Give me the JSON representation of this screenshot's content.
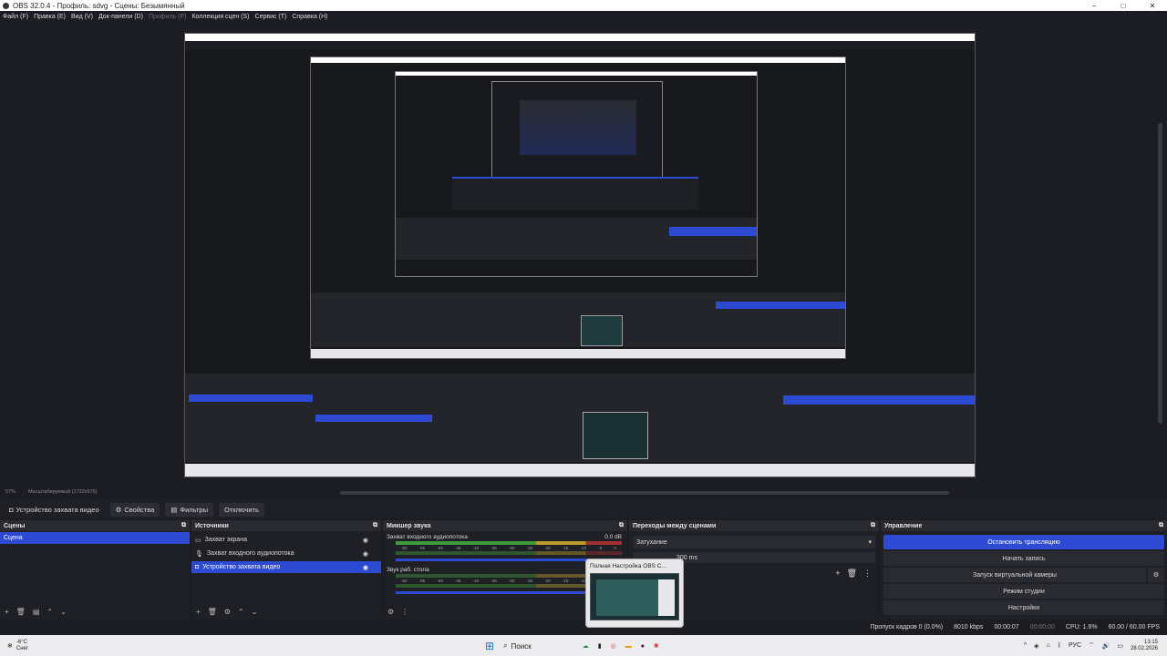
{
  "window": {
    "title": "OBS 32.0.4 - Профиль: sdvg - Сцены: Безымянный",
    "minimize": "–",
    "maximize": "□",
    "close": "✕"
  },
  "menu": [
    {
      "label": "Файл (F)",
      "disabled": false
    },
    {
      "label": "Правка (E)",
      "disabled": false
    },
    {
      "label": "Вид (V)",
      "disabled": false
    },
    {
      "label": "Док-панели (D)",
      "disabled": false
    },
    {
      "label": "Профиль (P)",
      "disabled": true
    },
    {
      "label": "Коллекция сцен (S)",
      "disabled": false
    },
    {
      "label": "Сервис (T)",
      "disabled": false
    },
    {
      "label": "Справка (H)",
      "disabled": false
    }
  ],
  "preview_bar": {
    "zoom": "57%",
    "scale_label": "Масштабируемый (1732x975)"
  },
  "toolbar": {
    "source_name": "Устройство захвата видео",
    "properties": "Свойства",
    "filters": "Фильтры",
    "deactivate": "Отключить"
  },
  "scenes": {
    "title": "Сцены",
    "items": [
      {
        "label": "Сцена",
        "selected": true
      }
    ]
  },
  "sources": {
    "title": "Источники",
    "items": [
      {
        "label": "Захват экрана",
        "icon": "monitor-icon",
        "selected": false
      },
      {
        "label": "Захват входного аудиопотока",
        "icon": "mic-icon",
        "selected": false
      },
      {
        "label": "Устройство захвата видео",
        "icon": "camera-icon",
        "selected": true
      }
    ]
  },
  "mixer": {
    "title": "Микшер звука",
    "tracks": [
      {
        "label": "Захват входного аудиопотока",
        "db": "0.0 dB"
      },
      {
        "label": "Звук раб. стола",
        "db": ""
      }
    ],
    "scale": [
      "-60",
      "-55",
      "-50",
      "-45",
      "-40",
      "-35",
      "-30",
      "-25",
      "-20",
      "-15",
      "-10",
      "-5",
      "0"
    ]
  },
  "transitions": {
    "title": "Переходы между сценами",
    "selected": "Затухание",
    "duration": "300 ms"
  },
  "controls": {
    "title": "Управление",
    "buttons": [
      {
        "label": "Остановить трансляцию",
        "active": true
      },
      {
        "label": "Начать запись",
        "active": false
      },
      {
        "label": "Запуск виртуальной камеры",
        "active": false
      },
      {
        "label": "Режим студии",
        "active": false
      },
      {
        "label": "Настройки",
        "active": false
      }
    ]
  },
  "status": {
    "dropped": "Пропуск кадров 0 (0.0%)",
    "bitrate": "8010 kbps",
    "stream_time": "00:00:07",
    "rec_time": "00:00:00",
    "cpu": "CPU: 1.6%",
    "fps": "60.00 / 60.00 FPS"
  },
  "taskbar": {
    "weather_temp": "-6°C",
    "weather_desc": "Снег",
    "search": "Поиск",
    "lang": "РУС",
    "time": "13:15",
    "date": "28.02.2026"
  },
  "tooltip": {
    "title": "Полная Настройка OBS С..."
  },
  "colors": {
    "accent": "#2c4ad2",
    "bg": "#1c1d22",
    "panel": "#1f2025"
  }
}
